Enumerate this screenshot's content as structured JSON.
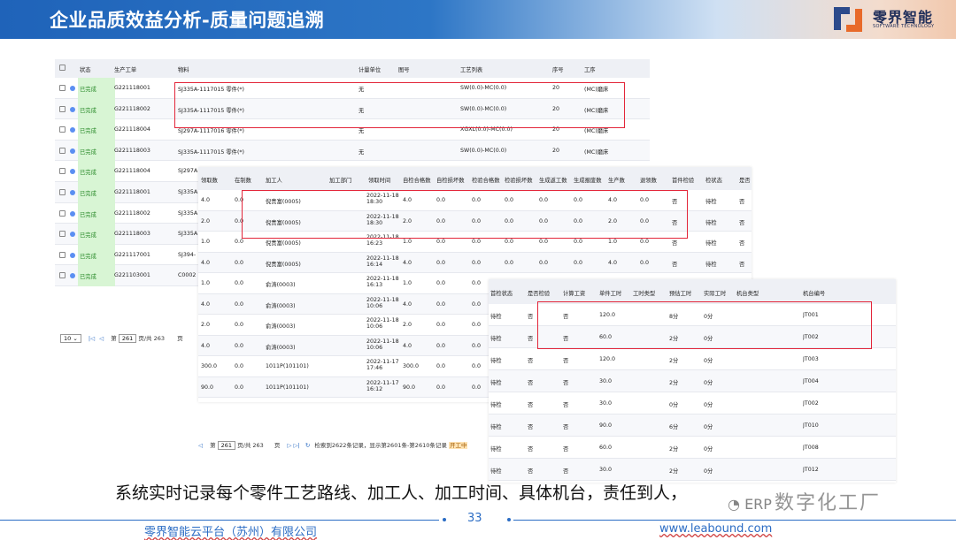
{
  "header": {
    "title": "企业品质效益分析-质量问题追溯",
    "brand": "零界智能",
    "brand_sub": "SOFTWARE TECHNOLOGY"
  },
  "panel1": {
    "headers": [
      "状态",
      "生产工单",
      "物料",
      "计量单位",
      "图号",
      "工艺列表",
      "序号",
      "工序"
    ],
    "rows": [
      [
        "已完成",
        "G221118001",
        "SJ335A-1117015 零件(*)",
        "无",
        "",
        "SW(0.0)-MC(0.0)",
        "20",
        "(MC)磨床"
      ],
      [
        "已完成",
        "G221118002",
        "SJ335A-1117015 零件(*)",
        "无",
        "",
        "SW(0.0)-MC(0.0)",
        "20",
        "(MC)磨床"
      ],
      [
        "已完成",
        "G221118004",
        "SJ297A-1117016 零件(*)",
        "无",
        "",
        "XGXL(0.0)-MC(0.0)",
        "20",
        "(MC)磨床"
      ],
      [
        "已完成",
        "G221118003",
        "SJ335A-1117015 零件(*)",
        "无",
        "",
        "SW(0.0)-MC(0.0)",
        "20",
        "(MC)磨床"
      ],
      [
        "已完成",
        "G221118004",
        "SJ297A",
        "",
        "",
        "",
        "",
        ""
      ],
      [
        "已完成",
        "G221118001",
        "SJ335A",
        "",
        "",
        "",
        "",
        ""
      ],
      [
        "已完成",
        "G221118002",
        "SJ335A",
        "",
        "",
        "",
        "",
        ""
      ],
      [
        "已完成",
        "G221118003",
        "SJ335A",
        "",
        "",
        "",
        "",
        ""
      ],
      [
        "已完成",
        "G221117001",
        "SJ394-",
        "",
        "",
        "",
        "",
        ""
      ],
      [
        "已完成",
        "G221103001",
        "C0002",
        "",
        "",
        "",
        "",
        ""
      ]
    ],
    "pager": {
      "size": "10",
      "page": "261",
      "pages_text": "页/共 263",
      "tail": "页",
      "first": "第"
    }
  },
  "panel2": {
    "headers": [
      "领取数",
      "在制数",
      "加工人",
      "加工部门",
      "领取时间",
      "自检合格数",
      "自检损坏数",
      "检验合格数",
      "检验损坏数",
      "生成返工数",
      "生成报废数",
      "生产数",
      "退领数",
      "首件检验",
      "检状态",
      "是否"
    ],
    "rows": [
      [
        "4.0",
        "0.0",
        "倪贵富(0005)",
        "",
        "2022-11-18 18:30",
        "4.0",
        "0.0",
        "0.0",
        "0.0",
        "0.0",
        "0.0",
        "4.0",
        "0.0",
        "否",
        "待检",
        "否"
      ],
      [
        "2.0",
        "0.0",
        "倪贵富(0005)",
        "",
        "2022-11-18 18:30",
        "2.0",
        "0.0",
        "0.0",
        "0.0",
        "0.0",
        "0.0",
        "2.0",
        "0.0",
        "否",
        "待检",
        "否"
      ],
      [
        "1.0",
        "0.0",
        "倪贵富(0005)",
        "",
        "2022-11-18 16:23",
        "1.0",
        "0.0",
        "0.0",
        "0.0",
        "0.0",
        "0.0",
        "1.0",
        "0.0",
        "否",
        "待检",
        "否"
      ],
      [
        "4.0",
        "0.0",
        "倪贵富(0005)",
        "",
        "2022-11-18 16:14",
        "4.0",
        "0.0",
        "0.0",
        "0.0",
        "0.0",
        "0.0",
        "4.0",
        "0.0",
        "否",
        "待检",
        "否"
      ],
      [
        "1.0",
        "0.0",
        "俞涛(0003)",
        "",
        "2022-11-18 16:13",
        "1.0",
        "0.0",
        "0.0",
        "",
        "",
        "",
        "",
        "",
        "",
        "",
        ""
      ],
      [
        "4.0",
        "0.0",
        "俞涛(0003)",
        "",
        "2022-11-18 10:06",
        "4.0",
        "0.0",
        "0.0",
        "",
        "",
        "",
        "",
        "",
        "",
        "",
        ""
      ],
      [
        "2.0",
        "0.0",
        "俞涛(0003)",
        "",
        "2022-11-18 10:06",
        "2.0",
        "0.0",
        "0.0",
        "",
        "",
        "",
        "",
        "",
        "",
        "",
        ""
      ],
      [
        "4.0",
        "0.0",
        "俞涛(0003)",
        "",
        "2022-11-18 10:06",
        "4.0",
        "0.0",
        "0.0",
        "",
        "",
        "",
        "",
        "",
        "",
        "",
        ""
      ],
      [
        "300.0",
        "0.0",
        "1011P(101101)",
        "",
        "2022-11-17 17:46",
        "300.0",
        "0.0",
        "0.0",
        "",
        "",
        "",
        "",
        "",
        "",
        "",
        ""
      ],
      [
        "90.0",
        "0.0",
        "1011P(101101)",
        "",
        "2022-11-17 16:12",
        "90.0",
        "0.0",
        "0.0",
        "",
        "",
        "",
        "",
        "",
        "",
        "",
        ""
      ]
    ],
    "pager": {
      "first": "第",
      "page": "261",
      "pages_text": "页/共 263",
      "tail": "页",
      "info": "检索到2622条记录，显示第2601条-第2610条记录",
      "tag": "开工中"
    }
  },
  "panel3": {
    "headers": [
      "首检状态",
      "是否检验",
      "计算工资",
      "单件工时",
      "工时类型",
      "预估工时",
      "实际工时",
      "机台类型",
      "机台编号"
    ],
    "rows": [
      [
        "待检",
        "否",
        "否",
        "120.0",
        "",
        "8分",
        "0分",
        "",
        "JT001"
      ],
      [
        "待检",
        "否",
        "否",
        "60.0",
        "",
        "2分",
        "0分",
        "",
        "JT002"
      ],
      [
        "待检",
        "否",
        "否",
        "120.0",
        "",
        "2分",
        "0分",
        "",
        "JT003"
      ],
      [
        "待检",
        "否",
        "否",
        "30.0",
        "",
        "2分",
        "0分",
        "",
        "JT004"
      ],
      [
        "待检",
        "否",
        "否",
        "30.0",
        "",
        "0分",
        "0分",
        "",
        "JT002"
      ],
      [
        "待检",
        "否",
        "否",
        "90.0",
        "",
        "6分",
        "0分",
        "",
        "JT010"
      ],
      [
        "待检",
        "否",
        "否",
        "60.0",
        "",
        "2分",
        "0分",
        "",
        "JT008"
      ],
      [
        "待检",
        "否",
        "否",
        "30.0",
        "",
        "2分",
        "0分",
        "",
        "JT012"
      ]
    ]
  },
  "caption": "系统实时记录每个零件工艺路线、加工人、加工时间、具体机台，责任到人，",
  "watermark": {
    "prefix": "ERP",
    "text": "数字化工厂"
  },
  "footer": {
    "company": "零界智能云平台（苏州）有限公司",
    "page": "33",
    "url": "www.leabound.com"
  },
  "colors": {
    "accent": "#2b6cc4",
    "highlight": "#e3263a",
    "done_bg": "#d8f5d4"
  }
}
